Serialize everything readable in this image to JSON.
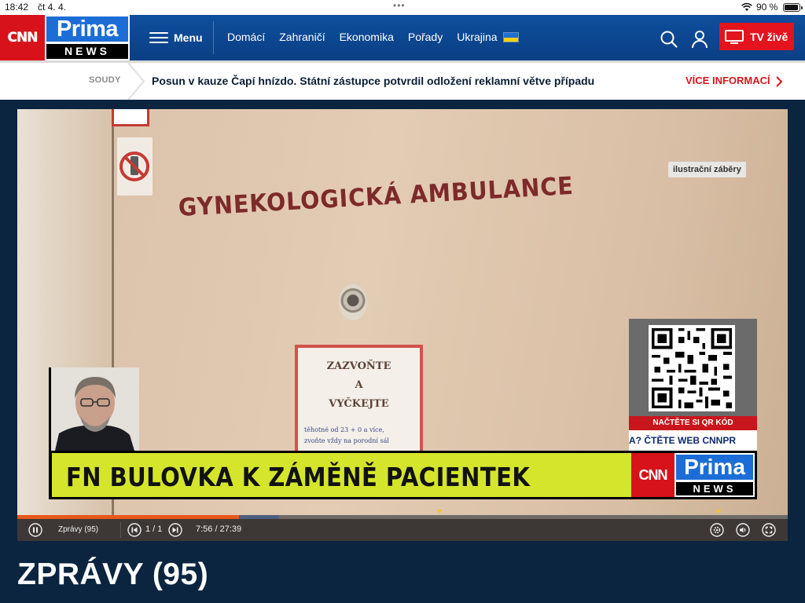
{
  "status_bar": {
    "time": "18:42",
    "date": "čt 4. 4.",
    "dots": "•••",
    "battery": "90 %"
  },
  "brand": {
    "cnn": "CNN",
    "prima": "Prima",
    "news": "NEWS"
  },
  "nav": {
    "menu_label": "Menu",
    "links": [
      "Domácí",
      "Zahraničí",
      "Ekonomika",
      "Pořady",
      "Ukrajina"
    ],
    "tv_label": "TV živě"
  },
  "ticker": {
    "tag": "SOUDY",
    "headline": "Posun v kauze Čapí hnízdo. Státní zástupce potvrdil odložení reklamní větve případu",
    "more": "VÍCE INFORMACÍ"
  },
  "video": {
    "illustration_note": "ilustrační záběry",
    "scene_sign": "GYNEKOLOGICKÁ AMBULANCE",
    "notice_lines": [
      "ZAZVOŇTE",
      "A",
      "VYČKEJTE"
    ],
    "notice_small": [
      "těhotné od 23 + 0 a více,",
      "zvoňte vždy na porodní sál"
    ],
    "caption": "FN BULOVKA K ZÁMĚNĚ PACIENTEK",
    "qr_label": "NAČTĚTE SI QR KÓD",
    "qr_web": "A? ČTĚTE WEB CNNPR",
    "progress_played": 0.288,
    "progress_buffered": 0.34,
    "controls": {
      "program": "Zprávy (95)",
      "pager": "1 / 1",
      "current_time": "7:56",
      "separator": "/",
      "duration": "27:39"
    }
  },
  "page_title": "ZPRÁVY (95)",
  "colors": {
    "brand_blue": "#0e4f9e",
    "cnn_red": "#d8121a",
    "accent_red": "#e3141d",
    "lower_third": "#d5e52c"
  }
}
